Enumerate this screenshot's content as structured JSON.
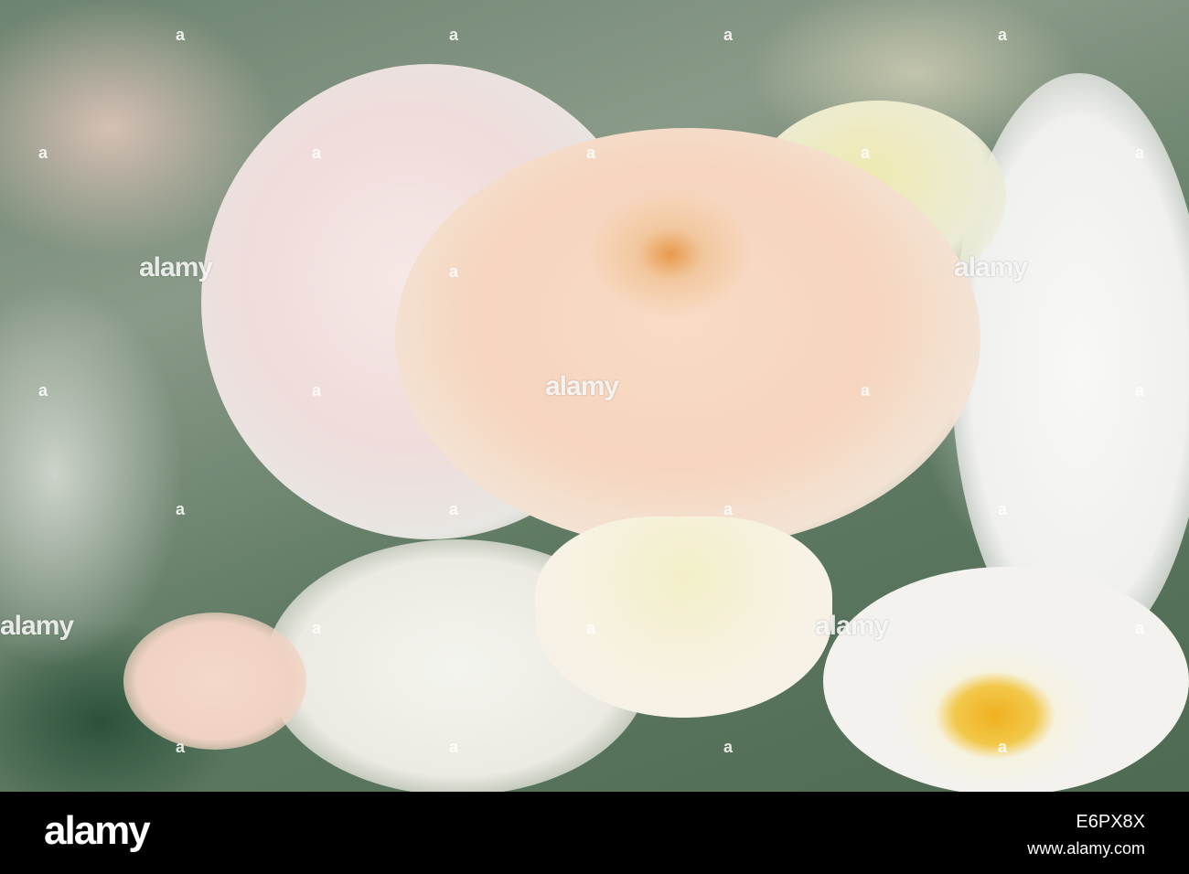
{
  "watermark": {
    "word": "alamy",
    "letter": "a"
  },
  "footer": {
    "logo": "alamy",
    "image_code": "E6PX8X",
    "url": "www.alamy.com"
  },
  "colors": {
    "rose_peach": "#f6d4bd",
    "stamen_yellow": "#f0b020",
    "leaf_green": "#4e6a52"
  }
}
